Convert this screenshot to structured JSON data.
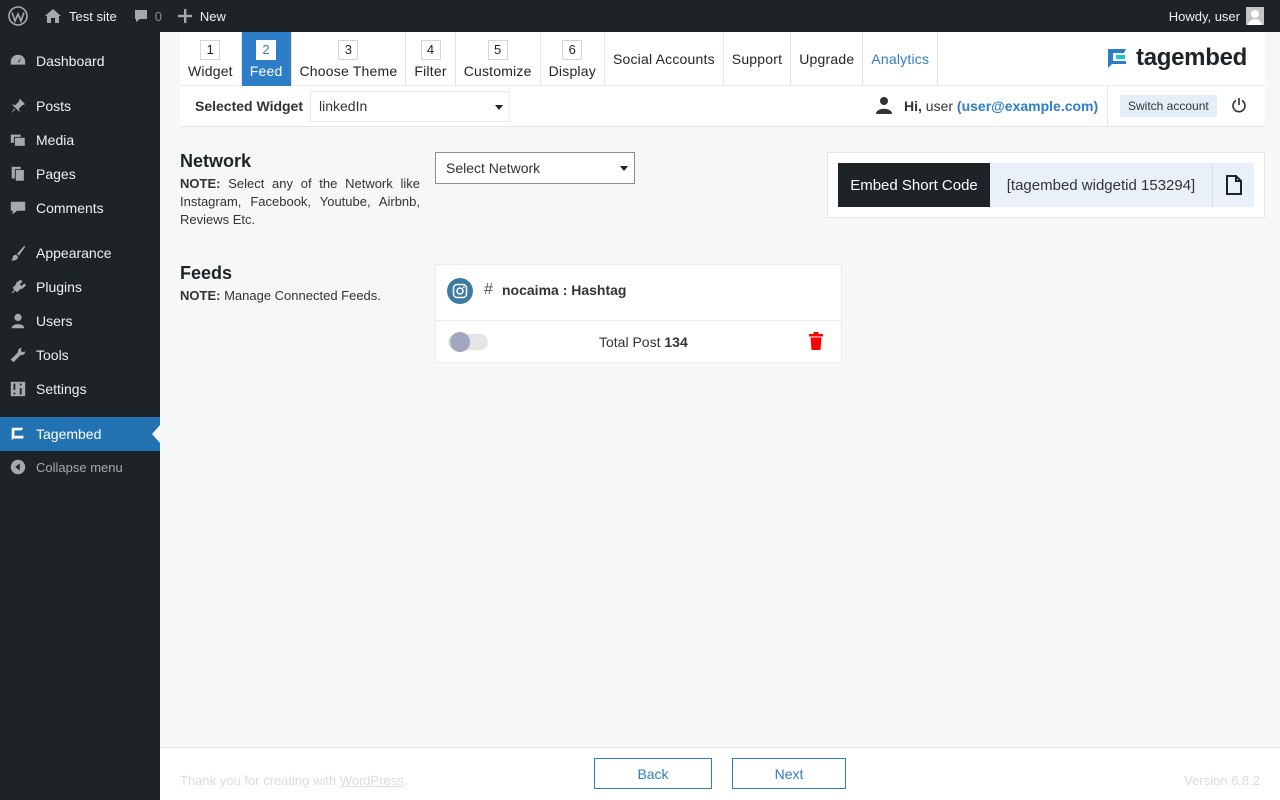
{
  "adminbar": {
    "site_name": "Test site",
    "comments_count": "0",
    "new_label": "New",
    "howdy": "Howdy, user"
  },
  "sidebar": {
    "items": [
      {
        "label": "Dashboard",
        "icon": "dashboard-icon"
      },
      {
        "label": "Posts",
        "icon": "pin-icon"
      },
      {
        "label": "Media",
        "icon": "media-icon"
      },
      {
        "label": "Pages",
        "icon": "pages-icon"
      },
      {
        "label": "Comments",
        "icon": "comment-icon"
      },
      {
        "label": "Appearance",
        "icon": "brush-icon"
      },
      {
        "label": "Plugins",
        "icon": "plug-icon"
      },
      {
        "label": "Users",
        "icon": "user-icon"
      },
      {
        "label": "Tools",
        "icon": "wrench-icon"
      },
      {
        "label": "Settings",
        "icon": "settings-icon"
      },
      {
        "label": "Tagembed",
        "icon": "tagembed-icon"
      },
      {
        "label": "Collapse menu",
        "icon": "collapse-icon"
      }
    ],
    "active": "Tagembed"
  },
  "nav": {
    "steps": [
      {
        "num": "1",
        "label": "Widget"
      },
      {
        "num": "2",
        "label": "Feed"
      },
      {
        "num": "3",
        "label": "Choose Theme"
      },
      {
        "num": "4",
        "label": "Filter"
      },
      {
        "num": "5",
        "label": "Customize"
      },
      {
        "num": "6",
        "label": "Display"
      }
    ],
    "active_step": "2",
    "links": [
      "Social Accounts",
      "Support",
      "Upgrade",
      "Analytics"
    ],
    "brand": "tagembed"
  },
  "widget_bar": {
    "label": "Selected Widget",
    "selected": "linkedIn",
    "hi": "Hi,",
    "user": "user",
    "email": "(user@example.com)",
    "switch_label": "Switch account"
  },
  "network": {
    "title": "Network",
    "note_bold": "NOTE:",
    "note": "Select any of the Network like Instagram, Facebook, Youtube, Airbnb, Reviews Etc.",
    "select_placeholder": "Select Network"
  },
  "embed": {
    "label": "Embed Short Code",
    "code": "[tagembed widgetid 153294]"
  },
  "feeds": {
    "title": "Feeds",
    "note_bold": "NOTE:",
    "note": "Manage Connected Feeds.",
    "items": [
      {
        "hash": "#",
        "name": "nocaima : Hashtag",
        "total_label": "Total Post",
        "total": "134",
        "network_icon": "instagram-icon"
      }
    ]
  },
  "footer": {
    "thanks": "Thank you for creating with",
    "wp_link": "WordPress",
    "thanks_end": ".",
    "back_label": "Back",
    "next_label": "Next",
    "version": "Version 6.8.2"
  },
  "colors": {
    "accent": "#2e7dc9",
    "admin_dark": "#1d2327",
    "danger": "#ff0000"
  }
}
